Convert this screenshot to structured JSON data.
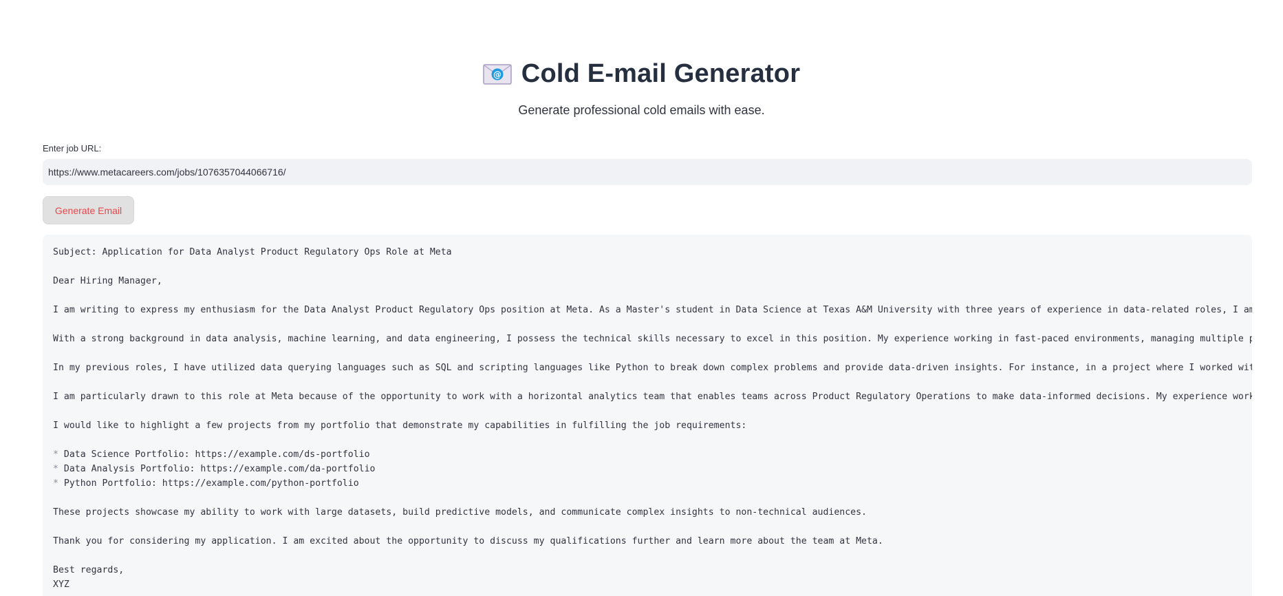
{
  "header": {
    "icon": "envelope-with-at-icon",
    "title": "Cold E-mail Generator",
    "subtitle": "Generate professional cold emails with ease."
  },
  "form": {
    "url_label": "Enter job URL:",
    "url_value": "https://www.metacareers.com/jobs/1076357044066716/",
    "button_label": "Generate Email"
  },
  "colors": {
    "button_text": "#e5484d",
    "input_background": "#f0f2f6",
    "code_background": "#f6f7f9",
    "title_text": "#262f3f"
  },
  "email": {
    "lines": [
      "Subject: Application for Data Analyst Product Regulatory Ops Role at Meta",
      "",
      "Dear Hiring Manager,",
      "",
      "I am writing to express my enthusiasm for the Data Analyst Product Regulatory Ops position at Meta. As a Master's student in Data Science at Texas A&M University with three years of experience in data-related roles, I am",
      "",
      "With a strong background in data analysis, machine learning, and data engineering, I possess the technical skills necessary to excel in this position. My experience working in fast-paced environments, managing multiple pr",
      "",
      "In my previous roles, I have utilized data querying languages such as SQL and scripting languages like Python to break down complex problems and provide data-driven insights. For instance, in a project where I worked with",
      "",
      "I am particularly drawn to this role at Meta because of the opportunity to work with a horizontal analytics team that enables teams across Product Regulatory Operations to make data-informed decisions. My experience worki",
      "",
      "I would like to highlight a few projects from my portfolio that demonstrate my capabilities in fulfilling the job requirements:",
      "",
      "* Data Science Portfolio: https://example.com/ds-portfolio",
      "* Data Analysis Portfolio: https://example.com/da-portfolio",
      "* Python Portfolio: https://example.com/python-portfolio",
      "",
      "These projects showcase my ability to work with large datasets, build predictive models, and communicate complex insights to non-technical audiences.",
      "",
      "Thank you for considering my application. I am excited about the opportunity to discuss my qualifications further and learn more about the team at Meta.",
      "",
      "Best regards,",
      "XYZ"
    ]
  }
}
